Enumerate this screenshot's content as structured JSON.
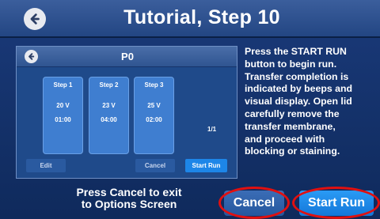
{
  "header": {
    "title": "Tutorial, Step 10",
    "back_icon": "arrow-left-circle-icon"
  },
  "preview": {
    "title": "P0",
    "steps": [
      {
        "label": "Step 1",
        "voltage": "20 V",
        "time": "01:00"
      },
      {
        "label": "Step 2",
        "voltage": "23 V",
        "time": "04:00"
      },
      {
        "label": "Step 3",
        "voltage": "25 V",
        "time": "02:00"
      }
    ],
    "page": "1/1",
    "edit_label": "Edit",
    "cancel_label": "Cancel",
    "start_label": "Start Run"
  },
  "instructions": {
    "lines": [
      "Press the START RUN",
      "button to begin run.",
      "Transfer completion is",
      "indicated by beeps and",
      "visual display. Open lid",
      "carefully remove the",
      "transfer membrane,",
      "and proceed with",
      "blocking or staining."
    ]
  },
  "footer": {
    "line1": "Press Cancel to exit",
    "line2": "to Options Screen",
    "cancel_label": "Cancel",
    "start_label": "Start Run"
  },
  "colors": {
    "background": "#0f2a5c",
    "header": "#234683",
    "start_button": "#1477d9",
    "highlight_ring": "#e01010"
  }
}
